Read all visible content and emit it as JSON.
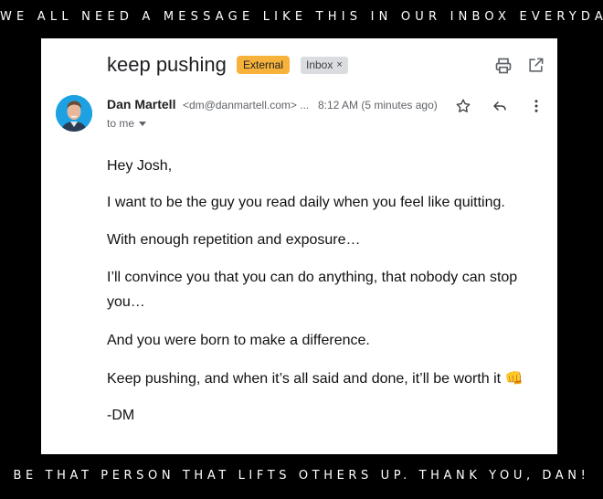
{
  "banner_top": "WE ALL NEED A MESSAGE LIKE THIS IN OUR INBOX EVERYDAY.",
  "banner_bottom": "BE THAT PERSON THAT LIFTS OTHERS UP. THANK YOU, DAN!",
  "email": {
    "subject": "keep pushing",
    "labels": {
      "external": "External",
      "inbox": "Inbox",
      "inbox_remove": "×"
    },
    "sender": {
      "name": "Dan Martell",
      "email": "<dm@danmartell.com> ..."
    },
    "timestamp": "8:12 AM (5 minutes ago)",
    "to_line": "to me",
    "body": [
      "Hey Josh,",
      "I want to be the guy you read daily when you feel like quitting.",
      "With enough repetition and exposure…",
      "I’ll convince you that you can do anything, that nobody can stop",
      "you…",
      "And you were born to make a difference.",
      "Keep pushing, and when it’s all said and done, it’ll be worth it 👊",
      "-DM"
    ]
  },
  "colors": {
    "background": "#000000",
    "card": "#ffffff",
    "external_chip": "#f6b23a",
    "inbox_chip": "#dadce0",
    "avatar_bg": "#1da1e2"
  },
  "icons": [
    "print-icon",
    "open-in-new-window-icon",
    "star-icon",
    "reply-icon",
    "more-options-icon"
  ]
}
